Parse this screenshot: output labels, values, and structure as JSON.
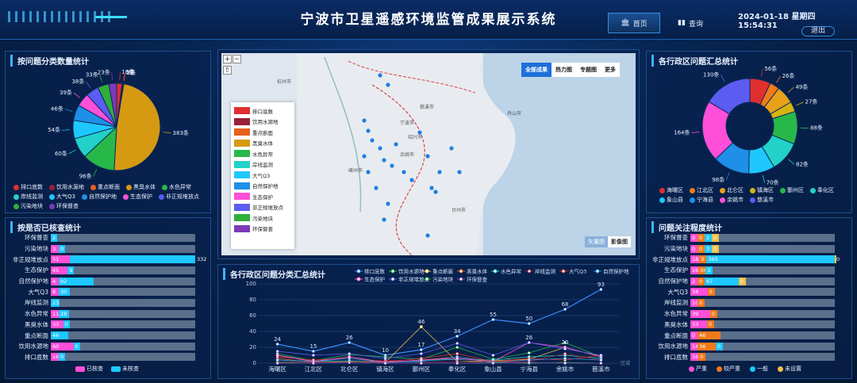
{
  "header": {
    "title": "宁波市卫星遥感环境监管成果展示系统",
    "home_label": "首页",
    "query_label": "查询",
    "datetime": "2024-01-18 星期四 15:54:31",
    "logout_label": "退出"
  },
  "panels": {
    "category_title": "按问题分类数量统计",
    "verify_title": "按是否已核查统计",
    "district_title": "各行政区问题汇总统计",
    "attention_title": "问题关注程度统计",
    "trend_title": "各行政区问题分类汇总统计"
  },
  "colors": {
    "accent": "#3fb4ff",
    "verified": "#ff4fd8",
    "unverified": "#1ec8ff",
    "severe": "#ff4fd8",
    "heavy": "#f27a1a",
    "normal": "#1ec8ff",
    "unset": "#f0c24a"
  },
  "category_pie": {
    "labels": [
      "排口底数",
      "饮用水源地",
      "重点断面",
      "黑臭水体",
      "水色异常",
      "岸线监测",
      "大气Q3",
      "自然保护地",
      "生态保护",
      "非正规堆放点",
      "污染地块",
      "环保督查"
    ],
    "values": [
      16,
      3,
      2,
      383,
      96,
      60,
      54,
      46,
      39,
      38,
      33,
      23
    ],
    "slice_labels": [
      "16条",
      "3条",
      "2条",
      "383条",
      "96条",
      "60条",
      "54条",
      "46条",
      "39条",
      "38条",
      "33条",
      "23条"
    ],
    "colors": [
      "#e02f2f",
      "#9b1f3a",
      "#e8601a",
      "#d69a12",
      "#28b84a",
      "#22d1c8",
      "#1ec8ff",
      "#1f8fe8",
      "#ff4fd8",
      "#5b5cf2",
      "#2fae3a",
      "#7c3ab8"
    ]
  },
  "district_donut": {
    "labels": [
      "海曙区",
      "江北区",
      "北仑区",
      "镇海区",
      "鄞州区",
      "奉化区",
      "象山县",
      "宁海县",
      "余姚市",
      "慈溪市"
    ],
    "values": [
      56,
      26,
      49,
      27,
      88,
      82,
      70,
      98,
      164,
      130
    ],
    "slice_labels": [
      "56条",
      "26条",
      "49条",
      "27条",
      "88条",
      "82条",
      "70条",
      "98条",
      "164条",
      "130条"
    ],
    "colors": [
      "#e02f2f",
      "#f27a1a",
      "#e8a21a",
      "#d6b412",
      "#28b84a",
      "#22d1c8",
      "#1ec8ff",
      "#1f8fe8",
      "#ff4fd8",
      "#5b5cf2"
    ]
  },
  "verify": {
    "legend_verified": "已核查",
    "legend_unverified": "未核查",
    "rows": [
      {
        "label": "环保督查",
        "a": "0",
        "b": "2"
      },
      {
        "label": "污染地块",
        "a": "3",
        "b": "0"
      },
      {
        "label": "非正规堆放点",
        "a": "51",
        "b": "332"
      },
      {
        "label": "生态保护",
        "a": "45",
        "b": "9"
      },
      {
        "label": "自然保护地",
        "a": "4",
        "b": "92"
      },
      {
        "label": "大气Q3",
        "a": "8",
        "b": "30"
      },
      {
        "label": "岸线监测",
        "a": "0",
        "b": "23"
      },
      {
        "label": "水色异常",
        "a": "11",
        "b": "28"
      },
      {
        "label": "黑臭水体",
        "a": "33",
        "b": "0"
      },
      {
        "label": "重点断面",
        "a": "0",
        "b": "46"
      },
      {
        "label": "饮用水源地",
        "a": "60",
        "b": "0"
      },
      {
        "label": "排口底数",
        "a": "16",
        "b": "0"
      }
    ]
  },
  "attention": {
    "legend": [
      "严重",
      "较严重",
      "一般",
      "未设置"
    ],
    "rows": [
      {
        "label": "环保督查",
        "vals": [
          "0",
          "0",
          "2",
          "0"
        ]
      },
      {
        "label": "污染地块",
        "vals": [
          "0",
          "0",
          "3",
          "0"
        ]
      },
      {
        "label": "非正规堆放点",
        "vals": [
          "18",
          "0",
          "365",
          "0"
        ]
      },
      {
        "label": "生态保护",
        "vals": [
          "16",
          "04",
          "3",
          ""
        ]
      },
      {
        "label": "自然保护地",
        "vals": [
          "2",
          "0",
          "67",
          "0"
        ]
      },
      {
        "label": "大气Q3",
        "vals": [
          "34",
          "0",
          "",
          ""
        ]
      },
      {
        "label": "岸线监测",
        "vals": [
          "10",
          "0",
          "",
          ""
        ]
      },
      {
        "label": "水色异常",
        "vals": [
          "39",
          "0",
          "",
          ""
        ]
      },
      {
        "label": "黑臭水体",
        "vals": [
          "33",
          "0",
          "",
          ""
        ]
      },
      {
        "label": "重点断面",
        "vals": [
          "0",
          "46",
          "",
          ""
        ]
      },
      {
        "label": "饮用水源地",
        "vals": [
          "14",
          "36",
          "0",
          ""
        ]
      },
      {
        "label": "排口底数",
        "vals": [
          "16",
          "0",
          "",
          ""
        ]
      }
    ]
  },
  "map": {
    "tabs": [
      "全部成果",
      "热力图",
      "专题图",
      "更多"
    ],
    "zoom_in": "+",
    "zoom_out": "−",
    "basemap_vector": "矢量图",
    "basemap_image": "影像图",
    "legend": [
      {
        "label": "排口底数",
        "color": "#e02f2f"
      },
      {
        "label": "饮用水源地",
        "color": "#9b1f3a"
      },
      {
        "label": "重点断面",
        "color": "#e8601a"
      },
      {
        "label": "黑臭水体",
        "color": "#d69a12"
      },
      {
        "label": "水色异常",
        "color": "#28b84a"
      },
      {
        "label": "岸线监测",
        "color": "#22d1c8"
      },
      {
        "label": "大气Q3",
        "color": "#1ec8ff"
      },
      {
        "label": "自然保护地",
        "color": "#1f8fe8"
      },
      {
        "label": "生态保护",
        "color": "#ff4fd8"
      },
      {
        "label": "非正规堆放点",
        "color": "#5b5cf2"
      },
      {
        "label": "污染地块",
        "color": "#2fae3a"
      },
      {
        "label": "环保督查",
        "color": "#7c3ab8"
      }
    ],
    "places": [
      "杭州市",
      "宁波市",
      "舟山市",
      "嵊州市",
      "绍兴市",
      "台州市",
      "慈溪市",
      "余姚市"
    ]
  },
  "chart_data": {
    "type": "line",
    "categories": [
      "海曙区",
      "江北区",
      "北仑区",
      "镇海区",
      "鄞州区",
      "奉化区",
      "象山县",
      "宁海县",
      "余姚市",
      "慈溪市"
    ],
    "xlabel": "区域",
    "ylim": [
      0,
      100
    ],
    "yticks": [
      0,
      20,
      40,
      60,
      80,
      100
    ],
    "series": [
      {
        "name": "排口底数",
        "color": "#3b8cff",
        "values": [
          24,
          15,
          26,
          10,
          17,
          34,
          55,
          50,
          68,
          93
        ]
      },
      {
        "name": "饮用水源地",
        "color": "#28b84a",
        "values": [
          12,
          3,
          11,
          8,
          5,
          20,
          5,
          13,
          26,
          8
        ]
      },
      {
        "name": "重点断面",
        "color": "#f0c24a",
        "values": [
          10,
          2,
          8,
          1,
          46,
          2,
          3,
          5,
          20,
          8
        ]
      },
      {
        "name": "黑臭水体",
        "color": "#e8601a",
        "values": [
          6,
          1,
          2,
          1,
          4,
          8,
          2,
          4,
          6,
          4
        ]
      },
      {
        "name": "水色异常",
        "color": "#22d1c8",
        "values": [
          4,
          2,
          3,
          2,
          3,
          5,
          4,
          8,
          10,
          6
        ]
      },
      {
        "name": "岸线监测",
        "color": "#9b1f3a",
        "values": [
          2,
          1,
          1,
          4,
          1,
          2,
          1,
          2,
          12,
          4
        ]
      },
      {
        "name": "大气Q3",
        "color": "#e02f2f",
        "values": [
          8,
          4,
          6,
          2,
          6,
          12,
          2,
          6,
          4,
          10
        ]
      },
      {
        "name": "自然保护地",
        "color": "#1f8fe8",
        "values": [
          4,
          2,
          6,
          1,
          2,
          8,
          1,
          4,
          6,
          4
        ]
      },
      {
        "name": "生态保护",
        "color": "#ff4fd8",
        "values": [
          10,
          2,
          8,
          1,
          4,
          6,
          2,
          26,
          20,
          8
        ]
      },
      {
        "name": "非正规堆放点",
        "color": "#5b5cf2",
        "values": [
          15,
          10,
          12,
          6,
          12,
          25,
          10,
          26,
          18,
          10
        ]
      },
      {
        "name": "污染地块",
        "color": "#2fae3a",
        "values": [
          1,
          0,
          1,
          0,
          0,
          0,
          1,
          0,
          1,
          0
        ]
      },
      {
        "name": "环保督查",
        "color": "#7c3ab8",
        "values": [
          0,
          0,
          1,
          0,
          0,
          0,
          0,
          1,
          0,
          0
        ]
      }
    ],
    "point_labels": [
      {
        "series": 0,
        "idx": 0,
        "text": "24"
      },
      {
        "series": 0,
        "idx": 1,
        "text": "15"
      },
      {
        "series": 0,
        "idx": 2,
        "text": "26"
      },
      {
        "series": 0,
        "idx": 3,
        "text": "10"
      },
      {
        "series": 0,
        "idx": 4,
        "text": "17"
      },
      {
        "series": 0,
        "idx": 5,
        "text": "34"
      },
      {
        "series": 0,
        "idx": 6,
        "text": "55"
      },
      {
        "series": 0,
        "idx": 7,
        "text": "50"
      },
      {
        "series": 0,
        "idx": 8,
        "text": "68"
      },
      {
        "series": 0,
        "idx": 9,
        "text": "93"
      },
      {
        "series": 2,
        "idx": 4,
        "text": "46"
      },
      {
        "series": 8,
        "idx": 7,
        "text": "26"
      },
      {
        "series": 8,
        "idx": 8,
        "text": "20"
      }
    ]
  }
}
